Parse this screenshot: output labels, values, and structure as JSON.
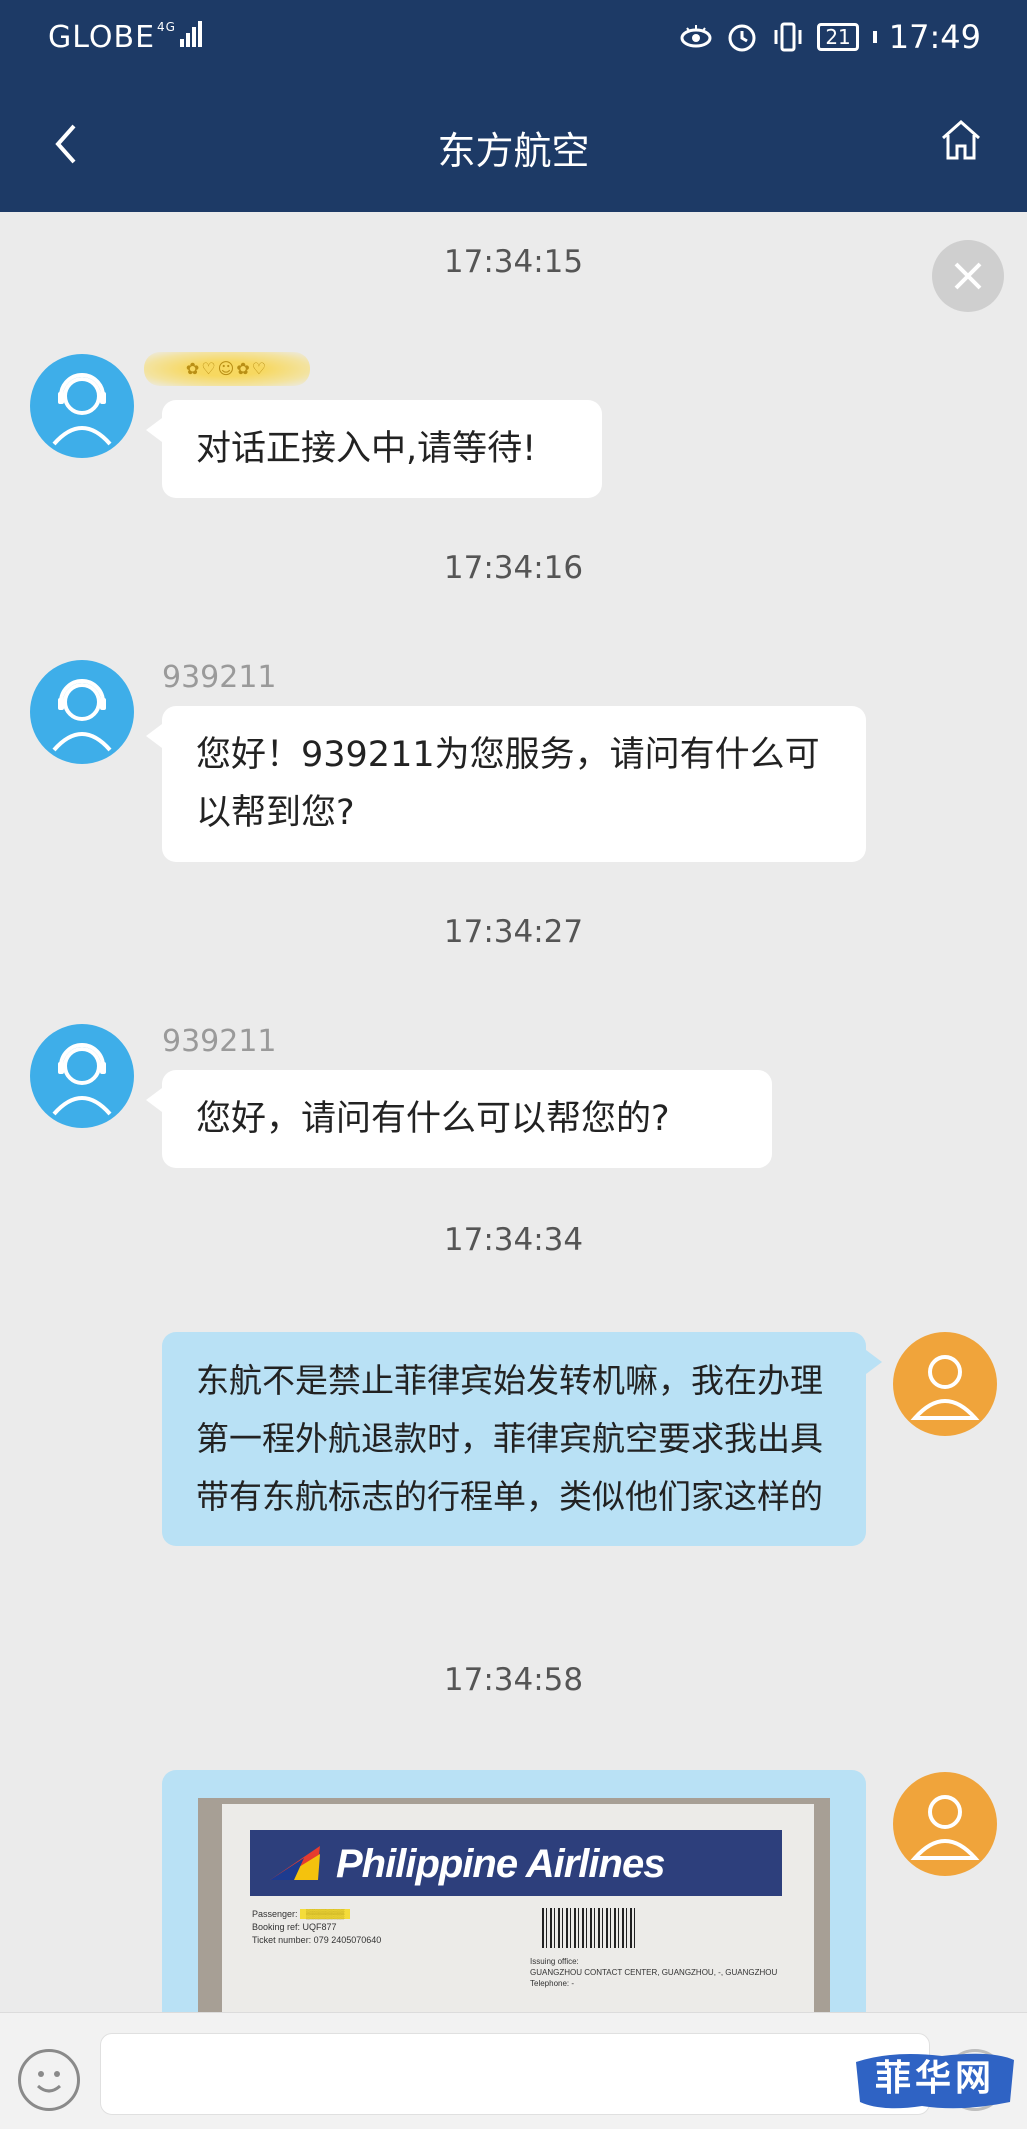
{
  "status_bar": {
    "carrier": "GLOBE",
    "network": "4G",
    "battery": "21",
    "time": "17:49"
  },
  "nav": {
    "title": "东方航空",
    "back_icon": "chevron-left-icon",
    "home_icon": "home-icon"
  },
  "chat": {
    "close_icon": "close-icon",
    "messages": [
      {
        "time": "17:34:15",
        "side": "agent",
        "sender": "",
        "text": "对话正接入中,请等待!"
      },
      {
        "time": "17:34:16",
        "side": "agent",
        "sender": "939211",
        "text": "您好！939211为您服务，请问有什么可以帮到您?"
      },
      {
        "time": "17:34:27",
        "side": "agent",
        "sender": "939211",
        "text": "您好，请问有什么可以帮您的?"
      },
      {
        "time": "17:34:34",
        "side": "user",
        "sender": "",
        "text": "东航不是禁止菲律宾始发转机嘛，我在办理第一程外航退款时，菲律宾航空要求我出具带有东航标志的行程单，类似他们家这样的"
      },
      {
        "time": "17:34:58",
        "side": "user",
        "sender": "",
        "image": {
          "airline": "Philippine Airlines",
          "passenger_label": "Passenger:",
          "booking_ref": "Booking ref: UQF877",
          "ticket_number": "Ticket number: 079 2405070640",
          "issuing_office_label": "Issuing office:",
          "issuing_office": "GUANGZHOU CONTACT CENTER, GUANGZHOU, -, GUANGZHOU",
          "telephone_label": "Telephone: -"
        }
      }
    ]
  },
  "input_bar": {
    "emoji_icon": "emoji-icon",
    "placeholder": "",
    "send_icon": "send-icon"
  },
  "watermark": {
    "text": "菲华网"
  },
  "colors": {
    "header": "#1d3a66",
    "agent_avatar": "#3eaee9",
    "user_avatar": "#f0a43b",
    "user_bubble": "#b9e1f5",
    "background": "#ebebeb"
  }
}
